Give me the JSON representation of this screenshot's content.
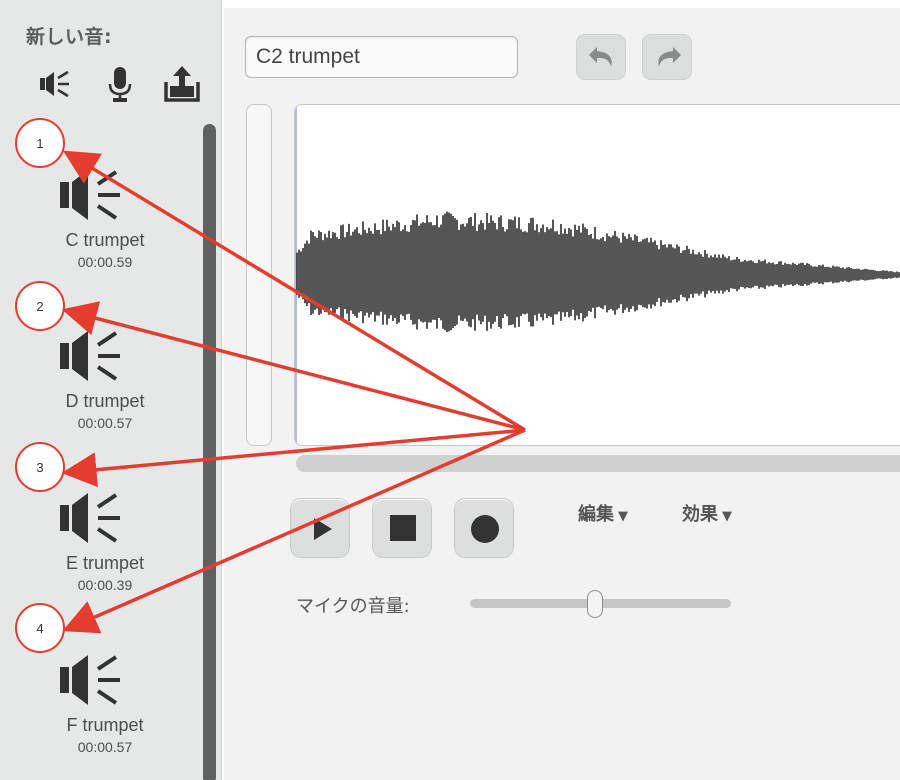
{
  "new_sound": {
    "label": "新しい音:",
    "icons": [
      "speaker-library-icon",
      "microphone-icon",
      "upload-icon"
    ]
  },
  "sounds": [
    {
      "marker": "1",
      "name": "C trumpet",
      "duration": "00:00.59"
    },
    {
      "marker": "2",
      "name": "D trumpet",
      "duration": "00:00.57"
    },
    {
      "marker": "3",
      "name": "E trumpet",
      "duration": "00:00.39"
    },
    {
      "marker": "4",
      "name": "F trumpet",
      "duration": "00:00.57"
    }
  ],
  "editor": {
    "sound_name": "C2 trumpet",
    "menus": {
      "edit": "編集",
      "effects": "効果"
    },
    "mic_volume_label": "マイクの音量:",
    "mic_volume_level": 0.48
  },
  "colors": {
    "panel_bg": "#e6e8e8",
    "editor_bg": "#f2f2f2",
    "annotation_red": "#e43d30",
    "waveform": "#2b2b2b"
  }
}
